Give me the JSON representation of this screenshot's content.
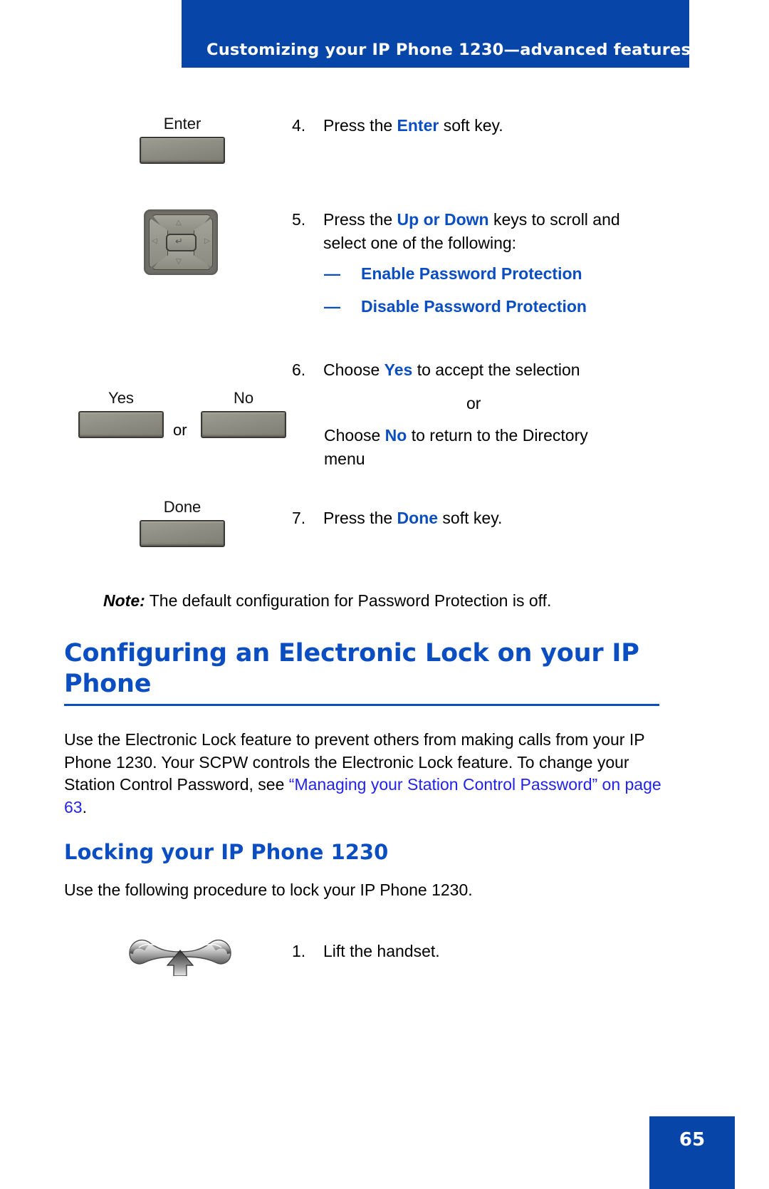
{
  "header": {
    "title": "Customizing your IP Phone 1230—advanced features",
    "band_color": "#0745a8"
  },
  "colors": {
    "heading_blue": "#0b4ec2",
    "keyword_blue": "#0b4ec2",
    "xref_blue": "#2222ee",
    "band_blue": "#0745a8",
    "key_gray": "#8e8e84"
  },
  "steps": [
    {
      "number": "4.",
      "icon": "softkey",
      "icon_label": "Enter",
      "text_parts": [
        {
          "t": "Press the ",
          "style": "plain"
        },
        {
          "t": "Enter",
          "style": "keyword"
        },
        {
          "t": " soft key.",
          "style": "plain"
        }
      ]
    },
    {
      "number": "5.",
      "icon": "navigation-cluster",
      "line1_parts": [
        {
          "t": "Press the ",
          "style": "plain"
        },
        {
          "t": "Up or Down",
          "style": "keyword"
        },
        {
          "t": " keys to scroll and",
          "style": "plain"
        }
      ],
      "line2": "select one of the following:"
    },
    {
      "number": "6.",
      "icon": "softkey-pair",
      "icon_label_yes": "Yes",
      "icon_label_no": "No",
      "icon_separator": "or",
      "line1_parts": [
        {
          "t": "Choose ",
          "style": "plain"
        },
        {
          "t": "Yes",
          "style": "keyword"
        },
        {
          "t": " to accept the selection",
          "style": "plain"
        }
      ],
      "separator": "or",
      "line2_parts": [
        {
          "t": "Choose ",
          "style": "plain"
        },
        {
          "t": "No",
          "style": "keyword"
        },
        {
          "t": " to return to the Directory",
          "style": "plain"
        }
      ],
      "line3": "menu"
    },
    {
      "number": "7.",
      "icon": "softkey",
      "icon_label": "Done",
      "text_parts": [
        {
          "t": "Press the ",
          "style": "plain"
        },
        {
          "t": "Done",
          "style": "keyword"
        },
        {
          "t": " soft key.",
          "style": "plain"
        }
      ]
    }
  ],
  "bullets": [
    {
      "dash": "—",
      "label": "Enable Password Protection"
    },
    {
      "dash": "—",
      "label": "Disable Password Protection"
    }
  ],
  "note": {
    "lead": "Note:",
    "text": " The default configuration for Password Protection is off."
  },
  "heading1": "Configuring an Electronic Lock on your IP Phone",
  "paragraph1": {
    "before": "Use the Electronic Lock feature to prevent others from making calls from your IP Phone 1230. Your SCPW controls the Electronic Lock feature. To change your Station Control Password, see ",
    "xref": "“Managing your Station Control Password” on page 63",
    "after": "."
  },
  "heading2": "Locking your IP Phone 1230",
  "paragraph2": "Use the following procedure to lock your IP Phone 1230.",
  "lock_steps": [
    {
      "number": "1.",
      "icon": "handset-lift",
      "text": "Lift the handset."
    }
  ],
  "footer": {
    "page_number": "65"
  }
}
